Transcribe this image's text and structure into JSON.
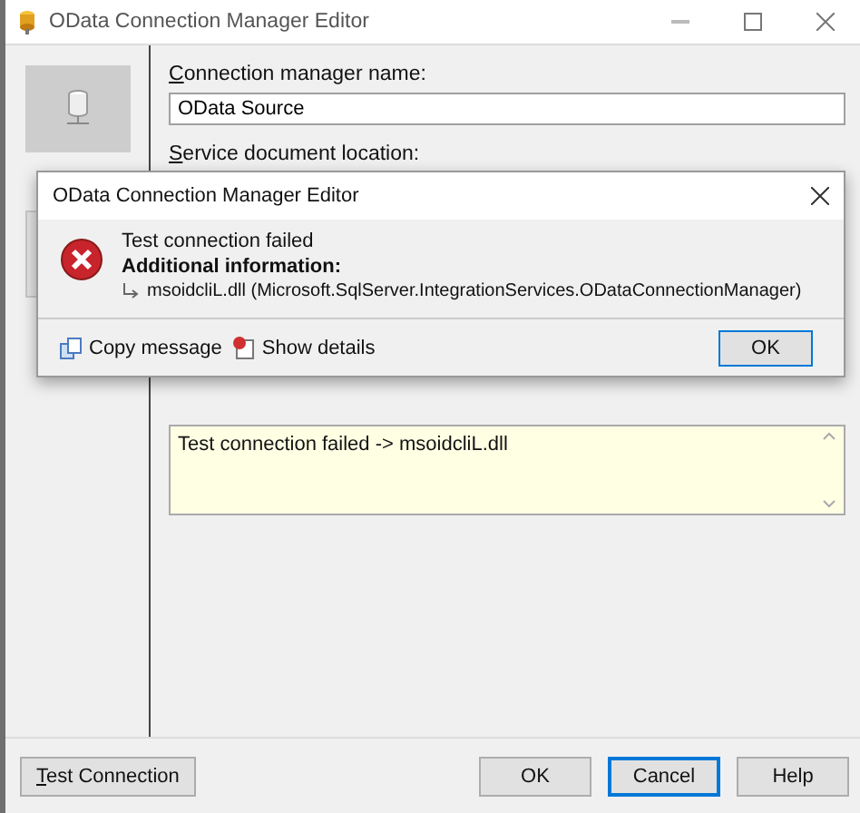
{
  "window": {
    "title": "OData Connection Manager Editor"
  },
  "fields": [
    {
      "label": "Connection manager name:",
      "mnemonic": true,
      "value": "OData Source"
    },
    {
      "label": "Service document location:",
      "mnemonic": true
    }
  ],
  "output": {
    "value": "Test connection failed -> msoidcliL.dll"
  },
  "buttons": [
    {
      "label": "Test Connection",
      "mnemonic": true,
      "focused": false,
      "kind": "left"
    },
    {
      "label": "OK",
      "focused": false,
      "kind": "right"
    },
    {
      "label": "Cancel",
      "focused": true,
      "kind": "right"
    },
    {
      "label": "Help",
      "focused": false,
      "kind": "right"
    }
  ],
  "dialog": {
    "title": "OData Connection Manager Editor",
    "message": "Test connection failed",
    "info_heading": "Additional information:",
    "info": "msoidcliL.dll (Microsoft.SqlServer.IntegrationServices.ODataConnectionManager)",
    "actions": [
      "Copy message",
      "Show details"
    ],
    "ok": "OK"
  }
}
